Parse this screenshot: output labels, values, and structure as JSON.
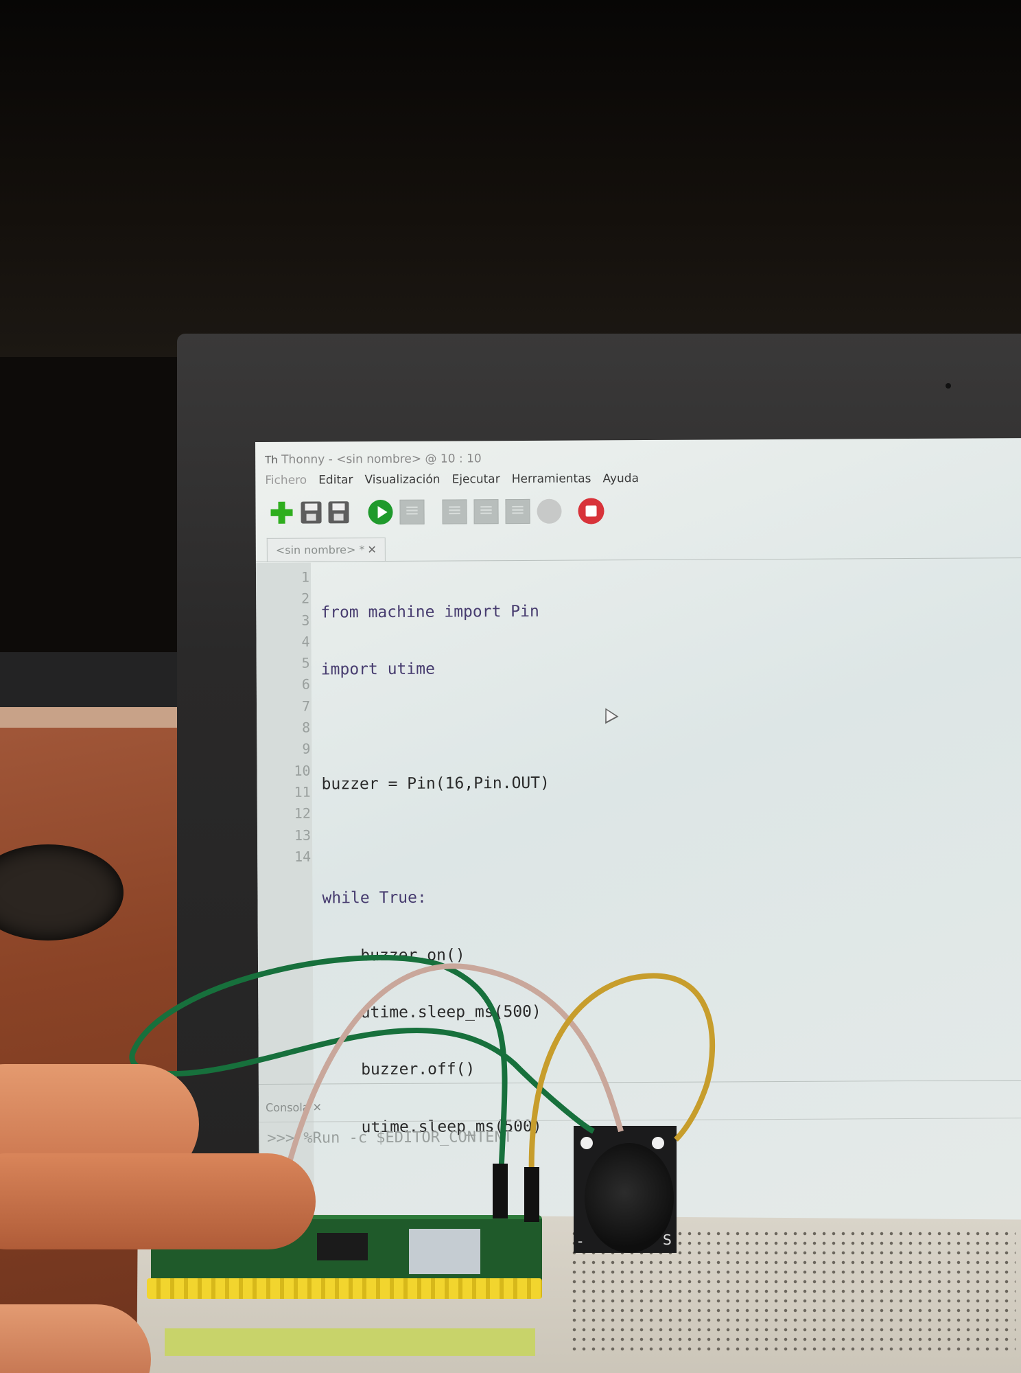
{
  "window": {
    "title": "Thonny  -  <sin nombre>  @  10 : 10"
  },
  "menu": [
    "Fichero",
    "Editar",
    "Visualización",
    "Ejecutar",
    "Herramientas",
    "Ayuda"
  ],
  "toolbar": {
    "icons": [
      "new-file-icon",
      "open-file-icon",
      "save-file-icon",
      "run-icon",
      "debug-icon",
      "step-over-icon",
      "step-into-icon",
      "step-out-icon",
      "resume-icon",
      "stop-icon",
      "ukraine-flag-icon"
    ],
    "colors": {
      "run": "#1f9a2c",
      "stop": "#d8333a",
      "new": "#2fae1e"
    }
  },
  "editor": {
    "tab_label": "<sin nombre> *",
    "tab_close": "✕",
    "line_numbers": [
      "1",
      "2",
      "3",
      "4",
      "5",
      "6",
      "7",
      "8",
      "9",
      "10",
      "11",
      "12",
      "13",
      "14"
    ],
    "code": [
      "from machine import Pin",
      "import utime",
      "",
      "buzzer = Pin(16,Pin.OUT)",
      "",
      "while True:",
      "    buzzer.on()",
      "    utime.sleep_ms(500)",
      "    buzzer.off()",
      "    utime.sleep_ms(500)",
      "",
      "",
      "",
      ""
    ]
  },
  "console": {
    "tab_label": "Consola",
    "tab_close": "✕",
    "prompt": ">>>",
    "command": "%Run -c $EDITOR_CONTENT"
  },
  "hardware": {
    "buzzer_pin_label": "S",
    "buzzer_minus_label": "-"
  }
}
